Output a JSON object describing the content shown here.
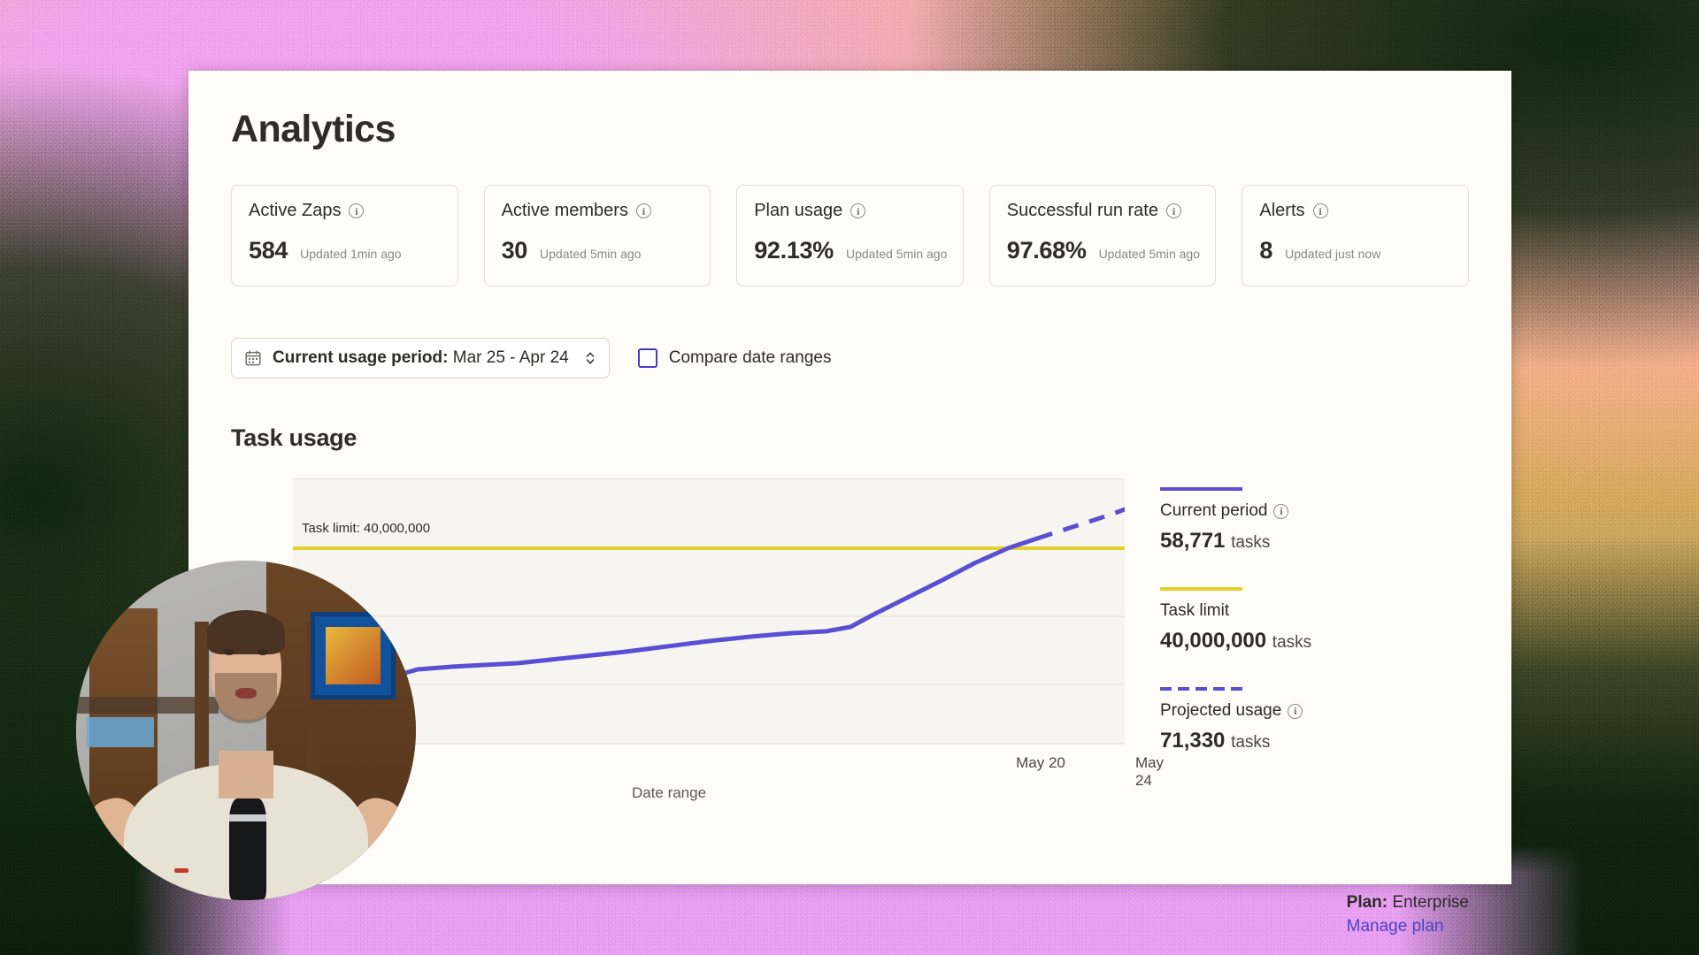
{
  "page": {
    "title": "Analytics"
  },
  "stats": [
    {
      "label": "Active Zaps",
      "icon": "info-icon",
      "value": "584",
      "updated": "Updated 1min ago"
    },
    {
      "label": "Active members",
      "icon": "info-icon",
      "value": "30",
      "updated": "Updated 5min ago"
    },
    {
      "label": "Plan usage",
      "icon": "info-icon",
      "value": "92.13%",
      "updated": "Updated 5min ago"
    },
    {
      "label": "Successful run rate",
      "icon": "info-icon",
      "value": "97.68%",
      "updated": "Updated 5min ago"
    },
    {
      "label": "Alerts",
      "icon": "info-icon",
      "value": "8",
      "updated": "Updated just now"
    }
  ],
  "controls": {
    "date_range": {
      "icon": "calendar-icon",
      "label": "Current usage period:",
      "value": "Mar 25 - Apr 24",
      "stepper_icon": "chevron-up-down-icon"
    },
    "compare": {
      "label": "Compare date ranges",
      "checked": false
    }
  },
  "chart_section": {
    "title": "Task usage"
  },
  "chart_data": {
    "type": "line",
    "title": "Task usage",
    "xlabel": "Date range",
    "ylabel": "",
    "x_tick_labels": [
      "May 20",
      "May 24"
    ],
    "x_tick_positions_pct": [
      89.5,
      102.5
    ],
    "annotation": "Task limit: 40,000,000",
    "limit_value": 40000000,
    "limit_color": "#e4cf2f",
    "line_color": "#5b4ed4",
    "grid": true,
    "series": [
      {
        "name": "Current period",
        "style": "solid",
        "color": "#5b4ed4",
        "points_pct": [
          [
            0.0,
            30.0
          ],
          [
            3.0,
            29.0
          ],
          [
            6.0,
            27.5
          ],
          [
            9.0,
            25.0
          ],
          [
            12.0,
            22.0
          ],
          [
            15.0,
            19.5
          ],
          [
            19.0,
            18.5
          ],
          [
            23.0,
            18.0
          ],
          [
            27.0,
            17.5
          ],
          [
            31.0,
            16.0
          ],
          [
            35.0,
            15.0
          ],
          [
            40.0,
            13.5
          ],
          [
            45.0,
            12.0
          ],
          [
            50.0,
            10.5
          ],
          [
            55.0,
            9.5
          ],
          [
            60.0,
            8.5
          ],
          [
            64.0,
            8.0
          ],
          [
            67.0,
            7.0
          ],
          [
            70.0,
            4.0
          ],
          [
            74.0,
            1.0
          ],
          [
            78.0,
            -2.0
          ],
          [
            82.0,
            -5.5
          ],
          [
            86.0,
            -9.0
          ],
          [
            89.5,
            -12.0
          ]
        ]
      },
      {
        "name": "Projected usage",
        "style": "dashed",
        "color": "#5b4ed4",
        "points_pct": [
          [
            89.5,
            -12.0
          ],
          [
            94.0,
            -16.0
          ],
          [
            98.0,
            -19.5
          ],
          [
            101.5,
            -23.0
          ]
        ]
      }
    ],
    "legend_position": "right"
  },
  "legend": [
    {
      "name": "Current period",
      "icon": "info-icon",
      "has_info": true,
      "swatch": "solid-purple",
      "value": "58,771",
      "unit": "tasks"
    },
    {
      "name": "Task limit",
      "has_info": false,
      "swatch": "solid-yellow",
      "value": "40,000,000",
      "unit": "tasks"
    },
    {
      "name": "Projected usage",
      "icon": "info-icon",
      "has_info": true,
      "swatch": "dashed-purple",
      "value": "71,330",
      "unit": "tasks"
    }
  ],
  "plan": {
    "label": "Plan:",
    "name": "Enterprise",
    "manage_link": "Manage plan"
  }
}
